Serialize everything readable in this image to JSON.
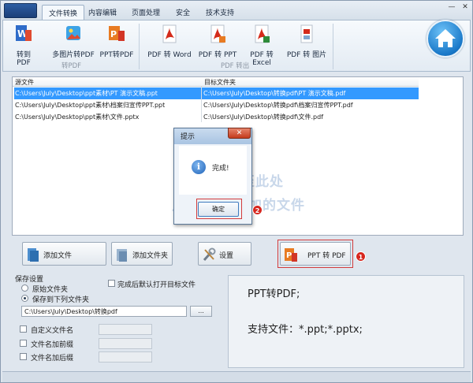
{
  "tabs": [
    {
      "label": "文件转换",
      "active": true
    },
    {
      "label": "内容编辑"
    },
    {
      "label": "页面处理"
    },
    {
      "label": "安全"
    },
    {
      "label": "技术支持"
    }
  ],
  "window_controls": {
    "minimize": "—",
    "close": "✕"
  },
  "ribbon": {
    "to_pdf_buttons": [
      "转到 PDF",
      "多图片转PDF",
      "PPT转PDF"
    ],
    "to_pdf_group": "转PDF",
    "from_pdf_buttons": [
      "PDF 转 Word",
      "PDF 转 PPT",
      "PDF 转 Excel",
      "PDF 转 图片"
    ],
    "from_pdf_group": "PDF 转出"
  },
  "file_list": {
    "columns": [
      "源文件",
      "目标文件夹"
    ],
    "rows": [
      {
        "source": "C:\\Users\\July\\Desktop\\ppt素材\\PT 演示文稿.ppt",
        "target": "C:\\Users\\July\\Desktop\\转换pdf\\PT 演示文稿.pdf",
        "selected": true
      },
      {
        "source": "C:\\Users\\July\\Desktop\\ppt素材\\档案归宣传PPT.ppt",
        "target": "C:\\Users\\July\\Desktop\\转换pdf\\档案归宣传PPT.pdf"
      },
      {
        "source": "C:\\Users\\July\\Desktop\\ppt素材\\文件.pptx",
        "target": "C:\\Users\\July\\Desktop\\转换pdf\\文件.pdf"
      }
    ],
    "hint_line1": "拖拽                    夹至此处",
    "hint_line2": "点击右键                    添加的文件"
  },
  "dialog": {
    "title": "提示",
    "close": "✕",
    "icon_glyph": "i",
    "message": "完成!",
    "ok_label": "确定",
    "badge": "2"
  },
  "actions": {
    "add_file": "添加文件",
    "add_folder": "添加文件夹",
    "settings": "设置",
    "convert": "PPT 转 PDF",
    "badge": "1"
  },
  "save_settings": {
    "legend": "保存设置",
    "option_original": "原始文件夹",
    "option_custom": "保存到下列文件夹",
    "open_after": "完成后默认打开目标文件",
    "path_value": "C:\\Users\\July\\Desktop\\转换pdf",
    "browse": "...",
    "custom_name": "自定义文件名",
    "prefix": "文件名加前缀",
    "suffix": "文件名加后缀"
  },
  "description": {
    "line1": "PPT转PDF;",
    "line2": "支持文件：*.ppt;*.pptx;"
  },
  "colors": {
    "selection": "#3399ff",
    "highlight": "#d23b3b",
    "badge": "#d7261e"
  },
  "icons": [
    "app-menu-icon",
    "word-to-pdf-icon",
    "images-to-pdf-icon",
    "ppt-to-pdf-icon",
    "pdf-to-word-icon",
    "pdf-to-ppt-icon",
    "pdf-to-excel-icon",
    "pdf-to-image-icon",
    "home-icon",
    "info-icon",
    "add-file-icon",
    "add-folder-icon",
    "settings-icon"
  ]
}
